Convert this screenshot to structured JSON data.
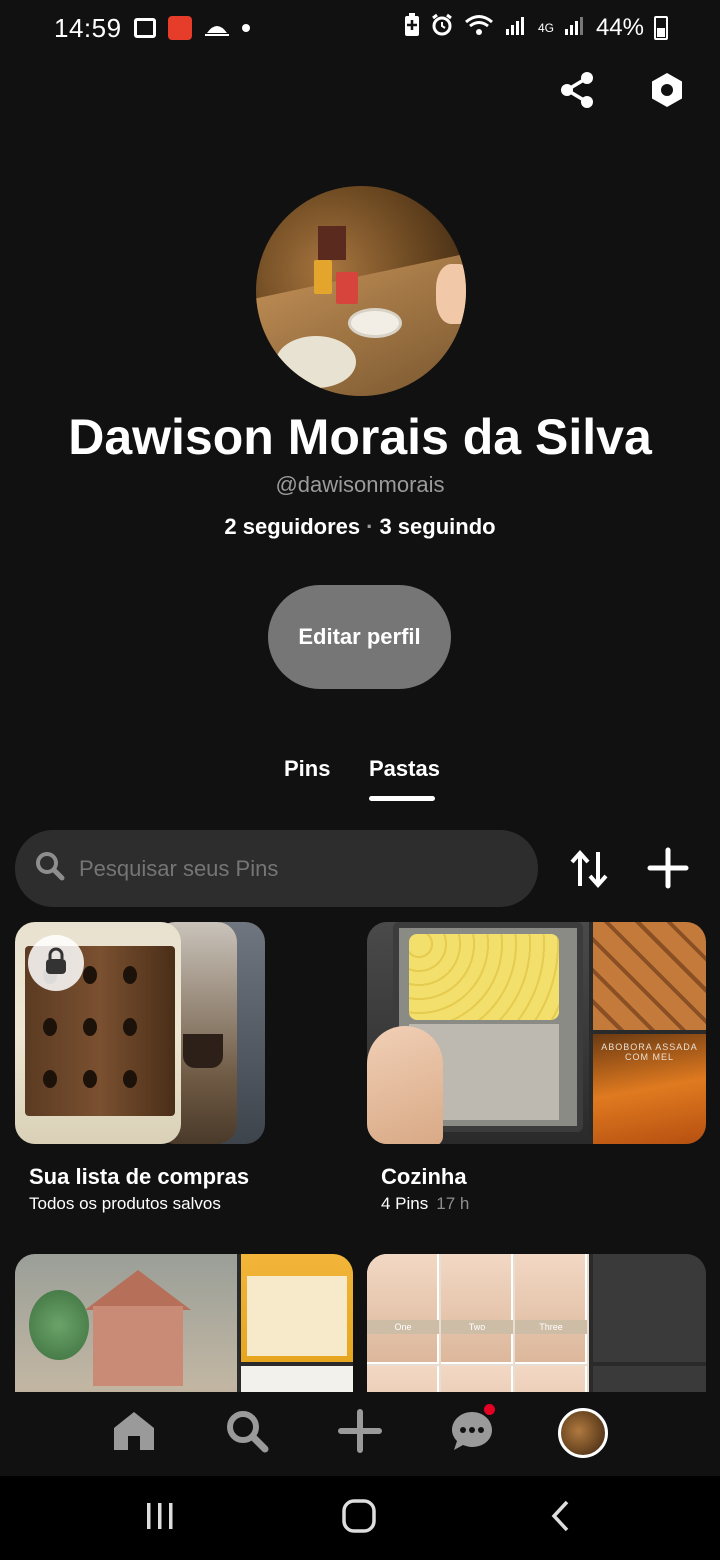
{
  "status_bar": {
    "time": "14:59",
    "battery": "44%",
    "network": "4G",
    "roaming": "R"
  },
  "profile": {
    "name": "Dawison Morais da Silva",
    "handle": "@dawisonmorais",
    "followers": "2 seguidores",
    "following": "3 seguindo",
    "separator": "·",
    "edit_label": "Editar perfil"
  },
  "tabs": [
    {
      "label": "Pins",
      "active": false
    },
    {
      "label": "Pastas",
      "active": true
    }
  ],
  "search": {
    "placeholder": "Pesquisar seus Pins"
  },
  "boards": [
    {
      "title": "Sua lista de compras",
      "subtitle": "Todos os produtos salvos",
      "time": "",
      "private": true
    },
    {
      "title": "Cozinha",
      "subtitle": "4 Pins",
      "time": "17 h",
      "private": false,
      "cover_text": "ABOBORA ASSADA COM MEL"
    },
    {
      "title": "",
      "subtitle": "",
      "time": "",
      "private": false
    },
    {
      "title": "",
      "subtitle": "",
      "time": "",
      "private": false,
      "cover_labels": [
        "One",
        "Two",
        "Three"
      ]
    }
  ],
  "icons": {
    "share": "share-icon",
    "settings": "settings-icon",
    "search": "search-icon",
    "sort": "sort-icon",
    "add": "plus-icon",
    "lock": "lock-icon",
    "home": "home-icon",
    "nav_search": "search-icon",
    "create": "plus-icon",
    "messages": "chat-icon",
    "profile": "avatar"
  },
  "colors": {
    "background": "#111111",
    "edit_button": "#767676",
    "search_bg": "#2d2d2d",
    "notification": "#e60023"
  }
}
